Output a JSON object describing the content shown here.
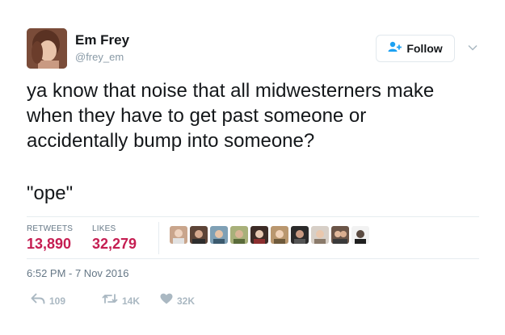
{
  "tweet": {
    "author": {
      "name": "Em Frey",
      "handle": "@frey_em"
    },
    "follow_label": "Follow",
    "text_lines": [
      "ya know that noise that all midwesterners make",
      "when they have to get past someone or",
      "accidentally bump into someone?"
    ],
    "quote": "\"ope\"",
    "stats": {
      "retweets_label": "RETWEETS",
      "retweets_value": "13,890",
      "likes_label": "LIKES",
      "likes_value": "32,279"
    },
    "timestamp": "6:52 PM - 7 Nov 2016",
    "actions": {
      "replies": "109",
      "retweets": "14K",
      "likes": "32K"
    }
  },
  "colors": {
    "stat_value": "#c51e52",
    "muted": "#657786",
    "action_gray": "#aab8c2",
    "follow_icon": "#1da1f2"
  },
  "icons": {
    "follow": "add-user-icon",
    "caret": "chevron-down-icon",
    "reply": "reply-icon",
    "retweet": "retweet-icon",
    "like": "heart-icon"
  }
}
